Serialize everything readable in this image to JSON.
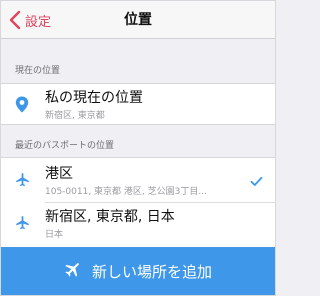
{
  "colors": {
    "accent_back": "#e0445d",
    "icon_blue": "#3f97ea",
    "button_blue": "#3f97ea"
  },
  "navbar": {
    "back_label": "設定",
    "title": "位置",
    "back_icon": "chevron-left-icon"
  },
  "current_location": {
    "header": "現在の位置",
    "icon": "location-pin-icon",
    "title": "私の現在の位置",
    "subtitle": "新宿区, 東京都"
  },
  "recent": {
    "header": "最近のパスポートの位置",
    "items": [
      {
        "icon": "airplane-icon",
        "title": "港区",
        "subtitle": "105-0011, 東京都 港区, 芝公園3丁目...",
        "selected": true
      },
      {
        "icon": "airplane-icon",
        "title": "新宿区, 東京都, 日本",
        "subtitle": "日本",
        "selected": false
      }
    ]
  },
  "add_button": {
    "label": "新しい場所を追加",
    "icon": "airplane-icon"
  }
}
